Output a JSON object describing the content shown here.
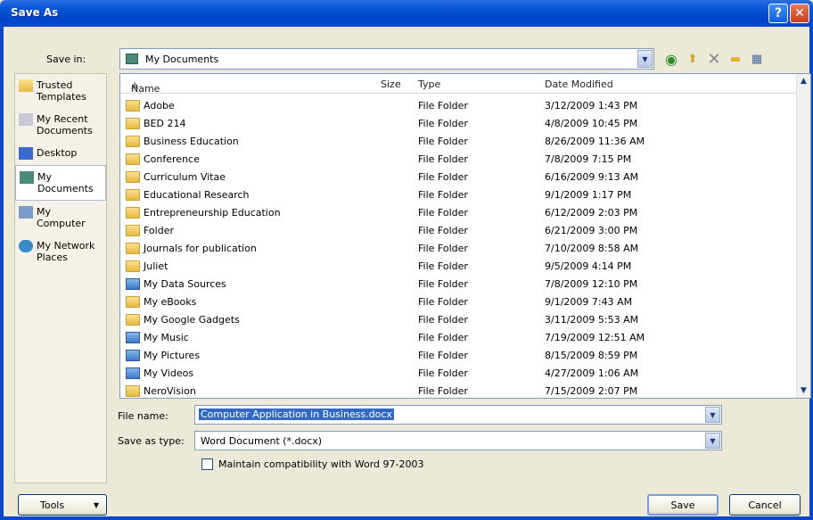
{
  "window": {
    "title": "Save As"
  },
  "toolbar": {
    "save_in_label": "Save in:",
    "save_in_value": "My Documents"
  },
  "places": [
    {
      "label": "Trusted Templates"
    },
    {
      "label": "My Recent Documents"
    },
    {
      "label": "Desktop"
    },
    {
      "label": "My Documents"
    },
    {
      "label": "My Computer"
    },
    {
      "label": "My Network Places"
    }
  ],
  "columns": {
    "name": "Name",
    "size": "Size",
    "type": "Type",
    "date": "Date Modified"
  },
  "files": [
    {
      "name": "Adobe",
      "type": "File Folder",
      "date": "3/12/2009 1:43 PM",
      "icon": "folder"
    },
    {
      "name": "BED 214",
      "type": "File Folder",
      "date": "4/8/2009 10:45 PM",
      "icon": "folder"
    },
    {
      "name": "Business Education",
      "type": "File Folder",
      "date": "8/26/2009 11:36 AM",
      "icon": "folder"
    },
    {
      "name": "Conference",
      "type": "File Folder",
      "date": "7/8/2009 7:15 PM",
      "icon": "folder"
    },
    {
      "name": "Curriculum Vitae",
      "type": "File Folder",
      "date": "6/16/2009 9:13 AM",
      "icon": "folder"
    },
    {
      "name": "Educational Research",
      "type": "File Folder",
      "date": "9/1/2009 1:17 PM",
      "icon": "folder"
    },
    {
      "name": "Entrepreneurship Education",
      "type": "File Folder",
      "date": "6/12/2009 2:03 PM",
      "icon": "folder"
    },
    {
      "name": "Folder",
      "type": "File Folder",
      "date": "6/21/2009 3:00 PM",
      "icon": "folder"
    },
    {
      "name": "Journals for publication",
      "type": "File Folder",
      "date": "7/10/2009 8:58 AM",
      "icon": "folder"
    },
    {
      "name": "Juliet",
      "type": "File Folder",
      "date": "9/5/2009 4:14 PM",
      "icon": "folder"
    },
    {
      "name": "My Data Sources",
      "type": "File Folder",
      "date": "7/8/2009 12:10 PM",
      "icon": "special"
    },
    {
      "name": "My eBooks",
      "type": "File Folder",
      "date": "9/1/2009 7:43 AM",
      "icon": "folder"
    },
    {
      "name": "My Google Gadgets",
      "type": "File Folder",
      "date": "3/11/2009 5:53 AM",
      "icon": "folder"
    },
    {
      "name": "My Music",
      "type": "File Folder",
      "date": "7/19/2009 12:51 AM",
      "icon": "special"
    },
    {
      "name": "My Pictures",
      "type": "File Folder",
      "date": "8/15/2009 8:59 PM",
      "icon": "special"
    },
    {
      "name": "My Videos",
      "type": "File Folder",
      "date": "4/27/2009 1:06 AM",
      "icon": "special"
    },
    {
      "name": "NeroVision",
      "type": "File Folder",
      "date": "7/15/2009 2:07 PM",
      "icon": "folder"
    }
  ],
  "form": {
    "file_name_label": "File name:",
    "file_name_value": "Computer Application in Business.docx",
    "save_type_label": "Save as type:",
    "save_type_value": "Word Document (*.docx)",
    "compat_label": "Maintain compatibility with Word 97-2003"
  },
  "buttons": {
    "tools": "Tools",
    "save": "Save",
    "cancel": "Cancel"
  }
}
